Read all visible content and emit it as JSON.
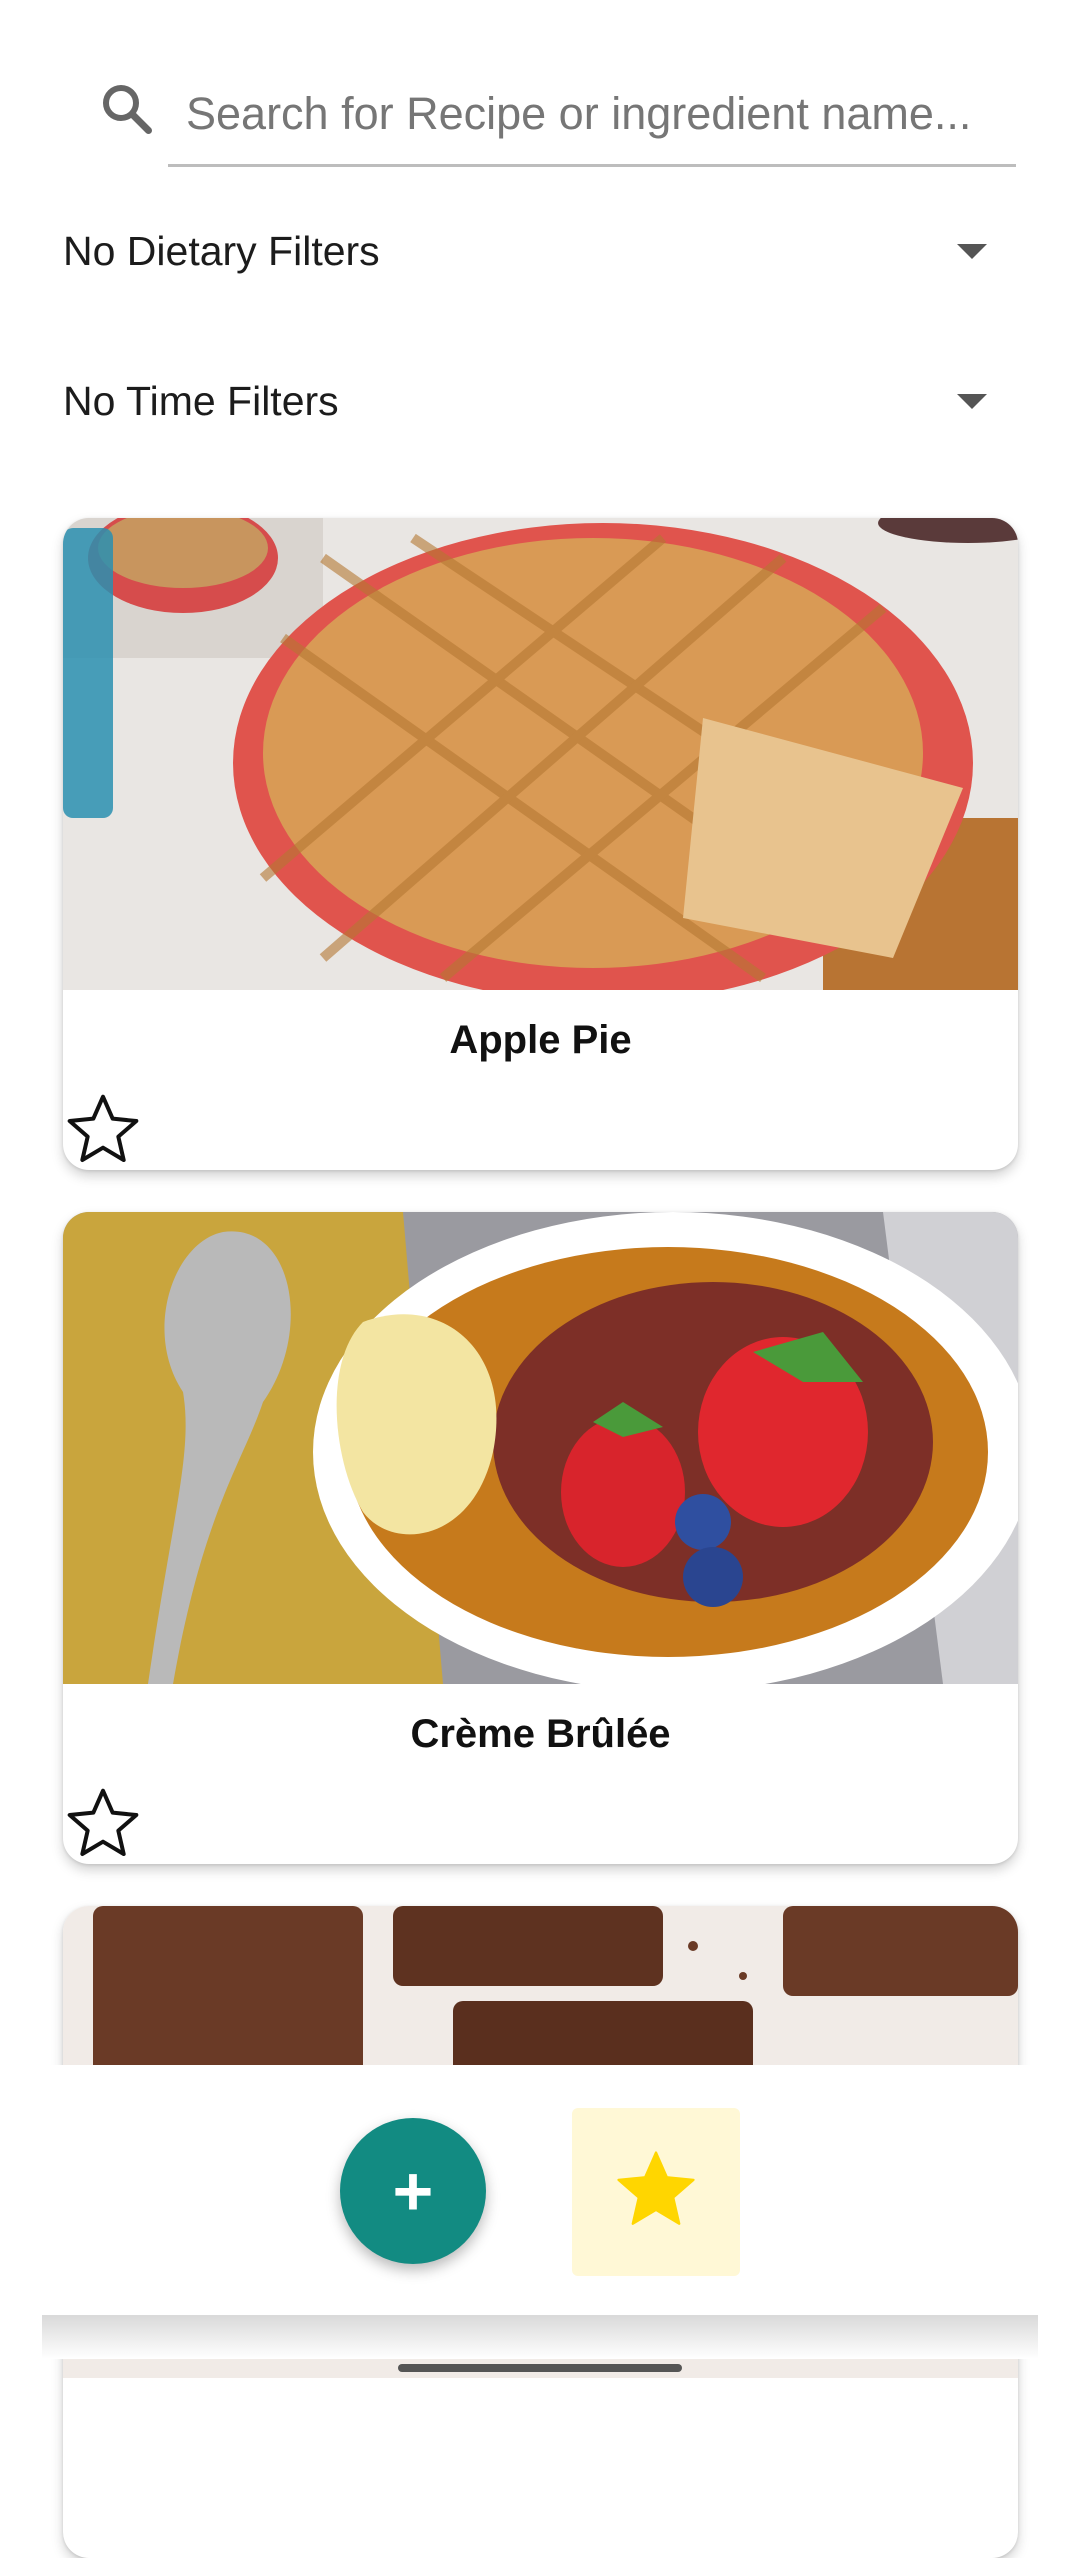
{
  "search": {
    "placeholder": "Search for Recipe or ingredient name...",
    "icon": "search-icon"
  },
  "filters": {
    "dietary": {
      "selected": "No Dietary Filters"
    },
    "time": {
      "selected": "No Time Filters"
    }
  },
  "recipes": [
    {
      "title": "Apple Pie",
      "favorited": false,
      "image": "apple-pie-photo"
    },
    {
      "title": "Crème Brûlée",
      "favorited": false,
      "image": "creme-brulee-photo"
    },
    {
      "title": "",
      "favorited": false,
      "image": "brownies-photo"
    }
  ],
  "actions": {
    "add_icon": "plus-icon",
    "add_label": "+",
    "favorites_icon": "star-icon"
  },
  "colors": {
    "accent": "#128b82",
    "favorites_bg": "#fff8d6",
    "star_fill": "#ffd600"
  }
}
